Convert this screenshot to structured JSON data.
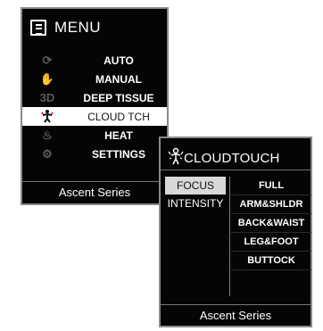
{
  "menu_screen": {
    "title": "MENU",
    "items": [
      {
        "label": "AUTO",
        "icon": "refresh-icon",
        "glyph": "⟳"
      },
      {
        "label": "MANUAL",
        "icon": "hand-icon",
        "glyph": "✋"
      },
      {
        "label": "DEEP TISSUE",
        "icon": "3d-icon",
        "glyph": "3D"
      },
      {
        "label": "CLOUD TCH",
        "icon": "person-icon",
        "glyph": "🕴"
      },
      {
        "label": "HEAT",
        "icon": "flame-icon",
        "glyph": "♨"
      },
      {
        "label": "SETTINGS",
        "icon": "gear-icon",
        "glyph": "⚙"
      }
    ],
    "selected_index": 3,
    "footer": "Ascent Series"
  },
  "cloudtouch_screen": {
    "title": "CLOUDTOUCH",
    "tabs": [
      "FOCUS",
      "INTENSITY"
    ],
    "selected_tab": 0,
    "options": [
      "FULL",
      "ARM&SHLDR",
      "BACK&WAIST",
      "LEG&FOOT",
      "BUTTOCK"
    ],
    "footer": "Ascent Series"
  }
}
